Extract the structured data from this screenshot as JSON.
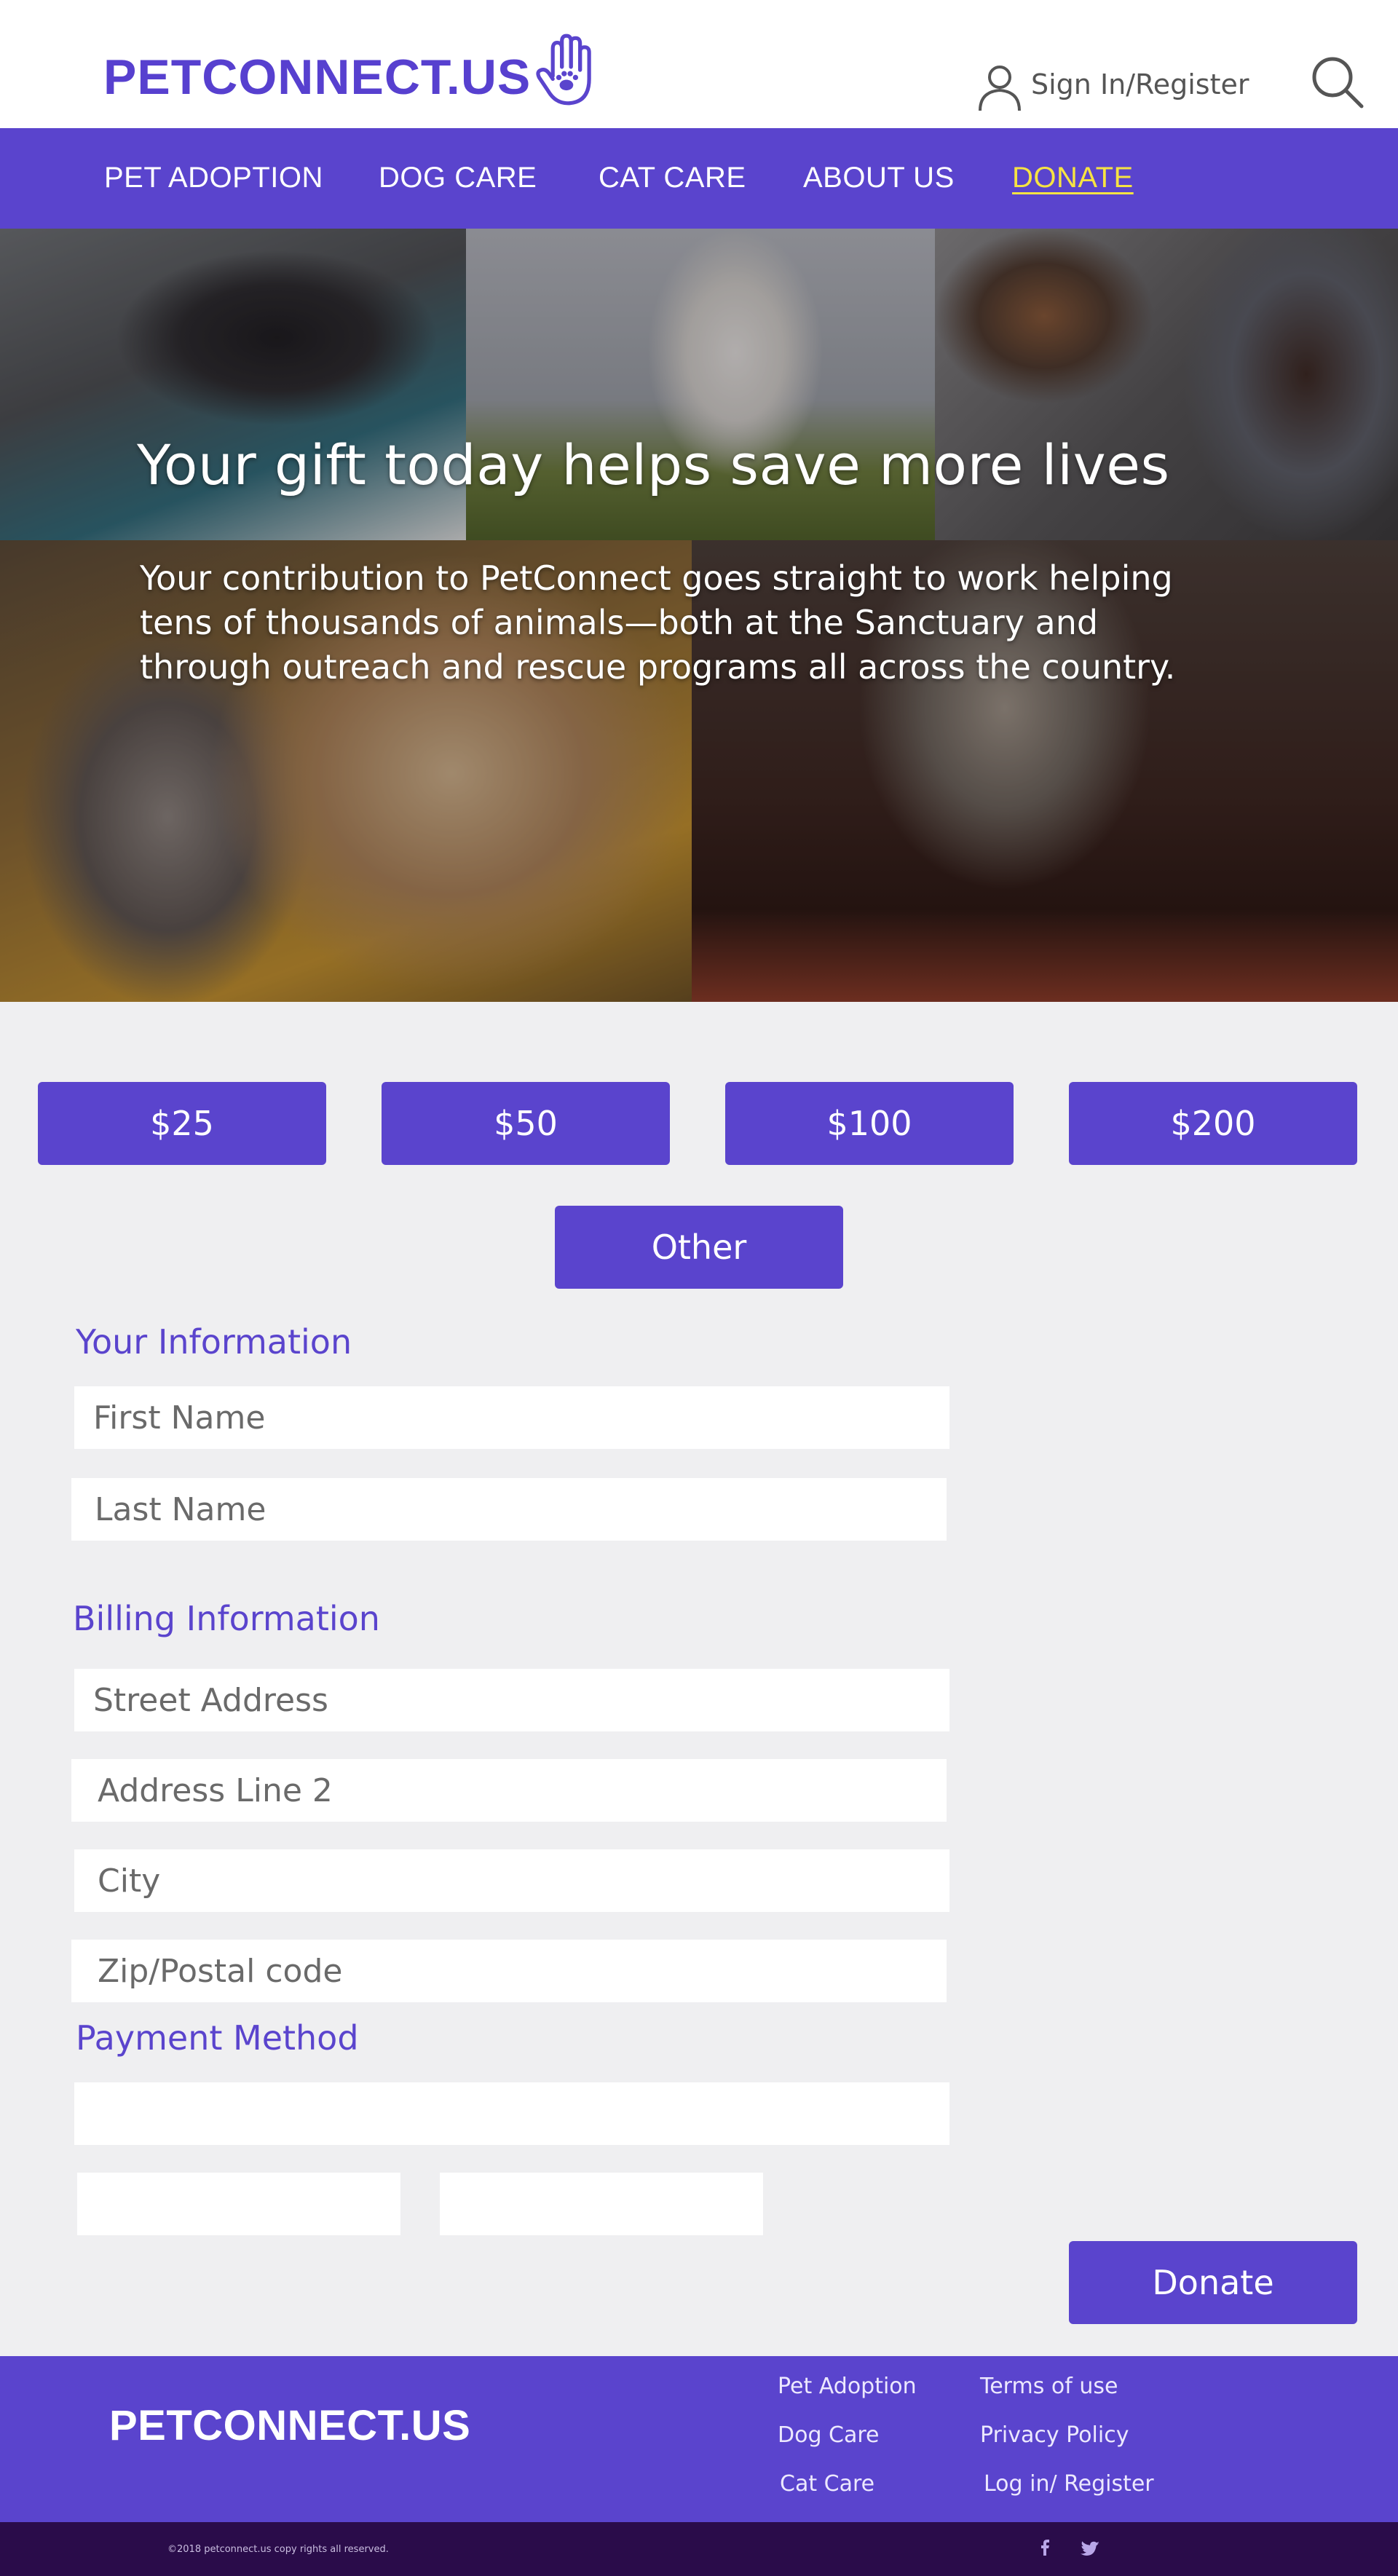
{
  "brand": {
    "name": "PETCONNECT.US",
    "accent": "#5a44cd",
    "highlight": "#f6e342"
  },
  "header": {
    "logo_text": "PETCONNECT.US",
    "signin_label": "Sign In/Register",
    "logo_icon": "paw-hand-icon",
    "user_icon": "user-icon",
    "search_icon": "search-icon"
  },
  "nav": {
    "items": [
      {
        "label": "PET ADOPTION",
        "active": false
      },
      {
        "label": "DOG CARE",
        "active": false
      },
      {
        "label": "CAT CARE",
        "active": false
      },
      {
        "label": "ABOUT US",
        "active": false
      },
      {
        "label": "DONATE",
        "active": true
      }
    ]
  },
  "hero": {
    "title": "Your gift today helps save more lives",
    "description_lines": [
      "Your contribution to PetConnect goes straight to work helping",
      " tens of thousands of animals—both at the Sanctuary and",
      "through outreach and rescue programs all across the country."
    ]
  },
  "donation": {
    "amounts": [
      "$25",
      "$50",
      "$100",
      "$200"
    ],
    "other_label": "Other",
    "submit_label": "Donate"
  },
  "form": {
    "your_info_title": "Your Information",
    "first_name_placeholder": "First Name",
    "last_name_placeholder": "Last Name",
    "billing_title": "Billing Information",
    "street_placeholder": "Street Address",
    "address2_placeholder": "Address Line 2",
    "city_placeholder": "City",
    "zip_placeholder": "Zip/Postal code",
    "payment_title": "Payment Method"
  },
  "footer": {
    "logo_text": "PETCONNECT.US",
    "col1": [
      "Pet Adoption",
      "Dog Care",
      "Cat Care"
    ],
    "col2": [
      "Terms of use",
      "Privacy Policy",
      "Log in/ Register"
    ],
    "copyright": "©2018  petconnect.us copy rights all reserved.",
    "social_icons": [
      "facebook-icon",
      "twitter-icon"
    ]
  }
}
